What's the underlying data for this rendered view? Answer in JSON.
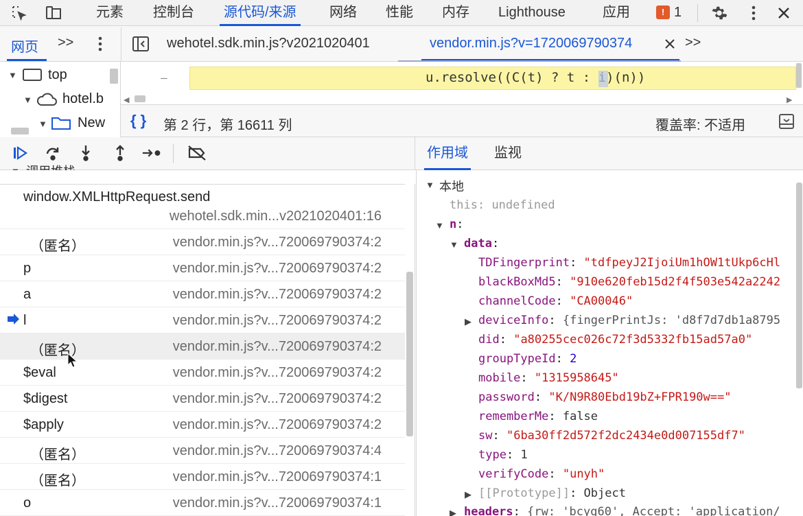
{
  "top_tabs": [
    "元素",
    "控制台",
    "源代码/来源",
    "网络",
    "性能",
    "内存",
    "Lighthouse",
    "应用"
  ],
  "issues_count": "1",
  "issues_icon": "!",
  "nav": {
    "page_tab": "网页",
    "more": ">>"
  },
  "files": {
    "tab1": "wehotel.sdk.min.js?v2021020401",
    "tab2": "vendor.min.js?v=1720069790374",
    "more": ">>"
  },
  "tree": {
    "top": "top",
    "host": "hotel.b",
    "folder": "New"
  },
  "code": {
    "line": "u.resolve((C(t) ? t : i)(n))",
    "gutter": "–"
  },
  "position": {
    "braces": "{ }",
    "text": "第 2 行，第 16611 列",
    "coverage": "覆盖率: 不适用"
  },
  "scope_tabs": {
    "scope": "作用域",
    "watch": "监视"
  },
  "callstack": {
    "header": "调用堆栈",
    "rows": [
      {
        "fn": "window.XMLHttpRequest.send",
        "loc": "wehotel.sdk.min...v2021020401:16"
      },
      {
        "fn": "（匿名）",
        "loc": "vendor.min.js?v...720069790374:2"
      },
      {
        "fn": "p",
        "loc": "vendor.min.js?v...720069790374:2"
      },
      {
        "fn": "a",
        "loc": "vendor.min.js?v...720069790374:2"
      },
      {
        "fn": "l",
        "loc": "vendor.min.js?v...720069790374:2"
      },
      {
        "fn": "（匿名）",
        "loc": "vendor.min.js?v...720069790374:2"
      },
      {
        "fn": "$eval",
        "loc": "vendor.min.js?v...720069790374:2"
      },
      {
        "fn": "$digest",
        "loc": "vendor.min.js?v...720069790374:2"
      },
      {
        "fn": "$apply",
        "loc": "vendor.min.js?v...720069790374:2"
      },
      {
        "fn": "（匿名）",
        "loc": "vendor.min.js?v...720069790374:4"
      },
      {
        "fn": "（匿名）",
        "loc": "vendor.min.js?v...720069790374:1"
      },
      {
        "fn": "o",
        "loc": "vendor.min.js?v...720069790374:1"
      }
    ]
  },
  "scope": {
    "local": "本地",
    "this_key": "this",
    "this_val": "undefined",
    "n_key": "n",
    "data_key": "data",
    "fields": [
      {
        "k": "TDFingerprint",
        "v": "\"tdfpeyJ2IjoiUm1hOW1tUkp6cHl",
        "t": "str"
      },
      {
        "k": "blackBoxMd5",
        "v": "\"910e620feb15d2f4f503e542a2242",
        "t": "str"
      },
      {
        "k": "channelCode",
        "v": "\"CA00046\"",
        "t": "str"
      },
      {
        "k": "deviceInfo",
        "v": "{fingerPrintJs: 'd8f7d7db1a8795",
        "t": "obj"
      },
      {
        "k": "did",
        "v": "\"a80255cec026c72f3d5332fb15ad57a0\"",
        "t": "str"
      },
      {
        "k": "groupTypeId",
        "v": "2",
        "t": "num"
      },
      {
        "k": "mobile",
        "v": "\"1315958645\"",
        "t": "str"
      },
      {
        "k": "password",
        "v": "\"K/N9R80Ebd19bZ+FPR190w==\"",
        "t": "str"
      },
      {
        "k": "rememberMe",
        "v": "false",
        "t": "plain"
      },
      {
        "k": "sw",
        "v": "\"6ba30ff2d572f2dc2434e0d007155df7\"",
        "t": "str"
      },
      {
        "k": "type",
        "v": "1",
        "t": "plain"
      },
      {
        "k": "verifyCode",
        "v": "\"unyh\"",
        "t": "str"
      },
      {
        "k": "[[Prototype]]",
        "v": "Object",
        "t": "proto"
      }
    ],
    "headers_key": "headers",
    "headers_val": "{rw: 'bcyg60', Accept: 'application/"
  }
}
